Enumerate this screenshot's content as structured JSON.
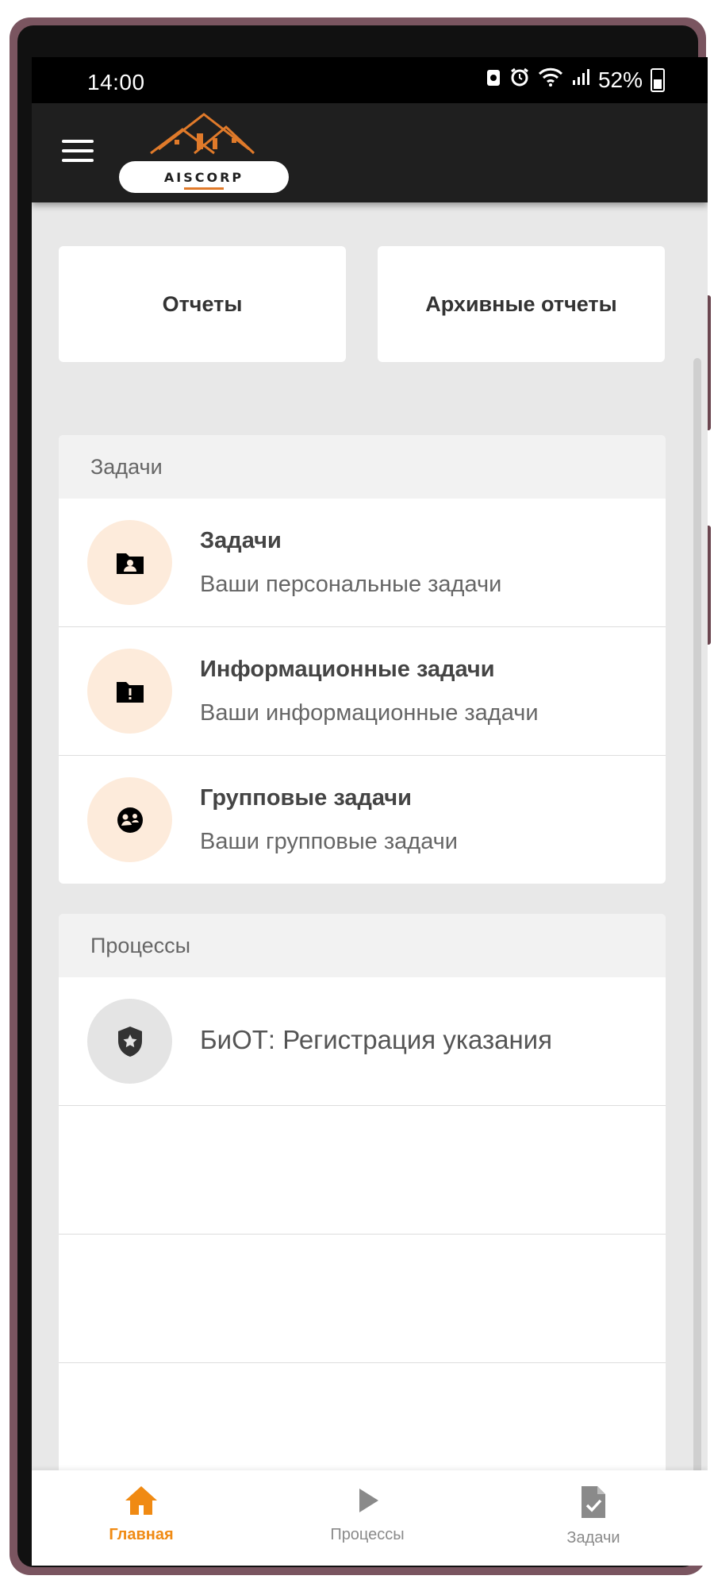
{
  "status_bar": {
    "time": "14:00",
    "battery_text": "52%"
  },
  "app_bar": {
    "menu_icon": "hamburger-menu-icon",
    "logo_text": "AISCORP"
  },
  "quick_tiles": [
    {
      "label": "Отчеты"
    },
    {
      "label": "Архивные отчеты"
    }
  ],
  "tasks_section": {
    "header": "Задачи",
    "items": [
      {
        "title": "Задачи",
        "subtitle": "Ваши персональные задачи",
        "icon": "folder-person-icon"
      },
      {
        "title": "Информационные задачи",
        "subtitle": "Ваши информационные задачи",
        "icon": "folder-alert-icon"
      },
      {
        "title": "Групповые задачи",
        "subtitle": "Ваши групповые задачи",
        "icon": "group-icon"
      }
    ]
  },
  "processes_section": {
    "header": "Процессы",
    "items": [
      {
        "title": "БиОТ: Регистрация указания",
        "icon": "shield-star-icon"
      }
    ]
  },
  "bottom_nav": {
    "items": [
      {
        "label": "Главная",
        "icon": "home-icon",
        "active": true
      },
      {
        "label": "Процессы",
        "icon": "play-icon",
        "active": false
      },
      {
        "label": "Задачи",
        "icon": "task-document-icon",
        "active": false
      }
    ]
  },
  "colors": {
    "accent": "#f08a13",
    "app_bar": "#1f1f1f",
    "icon_bg": "#fdebdb",
    "icon_bg_gray": "#e4e4e4",
    "inactive_nav": "#8a8a8a",
    "background": "#e8e8e8"
  }
}
